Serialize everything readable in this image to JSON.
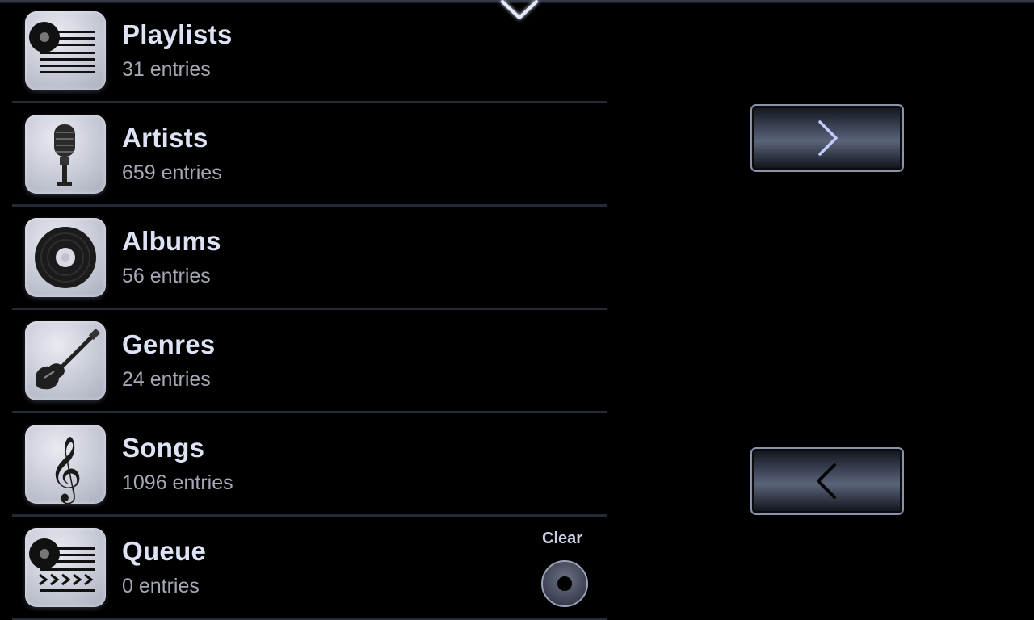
{
  "library": {
    "items": [
      {
        "icon": "playlist-icon",
        "title": "Playlists",
        "count": "31 entries"
      },
      {
        "icon": "microphone-icon",
        "title": "Artists",
        "count": "659 entries"
      },
      {
        "icon": "album-disc-icon",
        "title": "Albums",
        "count": "56 entries"
      },
      {
        "icon": "guitar-icon",
        "title": "Genres",
        "count": "24 entries"
      },
      {
        "icon": "treble-clef-icon",
        "title": "Songs",
        "count": "1096 entries"
      },
      {
        "icon": "queue-icon",
        "title": "Queue",
        "count": "0 entries"
      }
    ],
    "queue_clear_label": "Clear"
  },
  "navigation": {
    "next_icon": "chevron-right-icon",
    "prev_icon": "chevron-left-icon",
    "collapse_icon": "chevron-down-icon"
  },
  "colors": {
    "background": "#000000",
    "title_text": "#dde2f4",
    "subtitle_text": "#a4a8b4",
    "accent_glow": "#b9c3ff"
  }
}
